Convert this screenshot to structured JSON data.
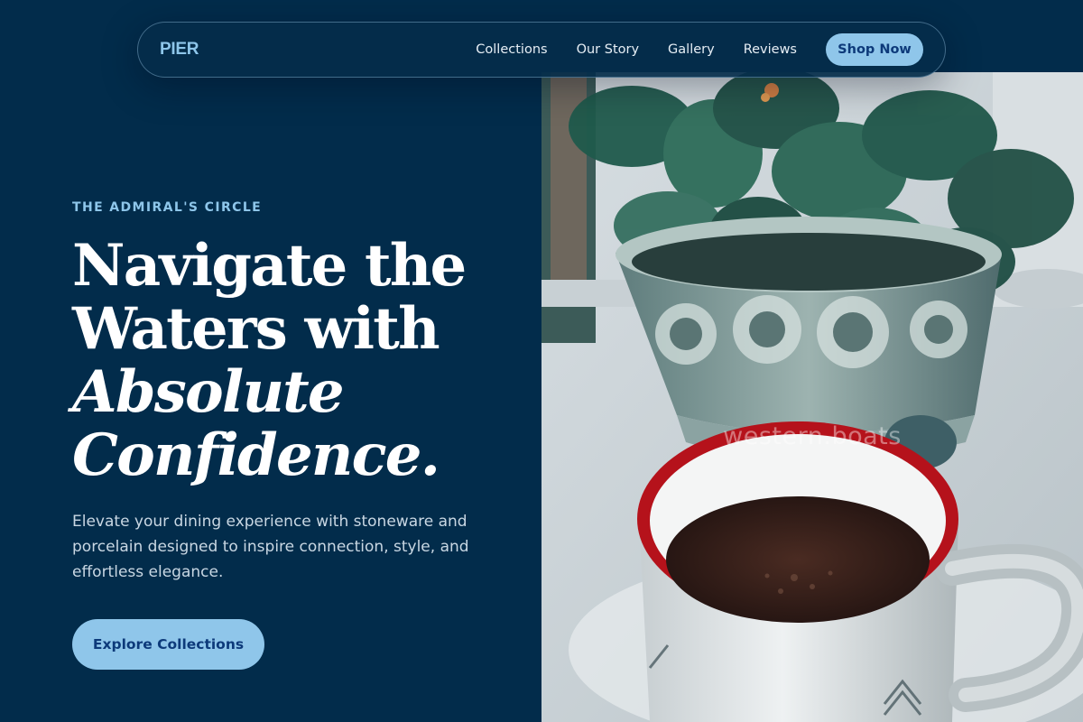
{
  "brand": "PIER",
  "nav": {
    "links": [
      "Collections",
      "Our Story",
      "Gallery",
      "Reviews"
    ],
    "cta_label": "Shop Now"
  },
  "hero": {
    "eyebrow": "THE ADMIRAL'S CIRCLE",
    "headline_lines": [
      "Navigate the",
      "Waters with",
      "Absolute",
      "Confidence."
    ],
    "subcopy": "Elevate your dining experience with stoneware and porcelain designed to inspire connection, style, and effortless elegance.",
    "cta_label": "Explore Collections",
    "watermark": "western.boats"
  },
  "colors": {
    "background": "#022c4b",
    "accent": "#8fc6ea",
    "accent_text": "#0d3a7a"
  },
  "icons": {
    "photo": "hero-photo"
  }
}
